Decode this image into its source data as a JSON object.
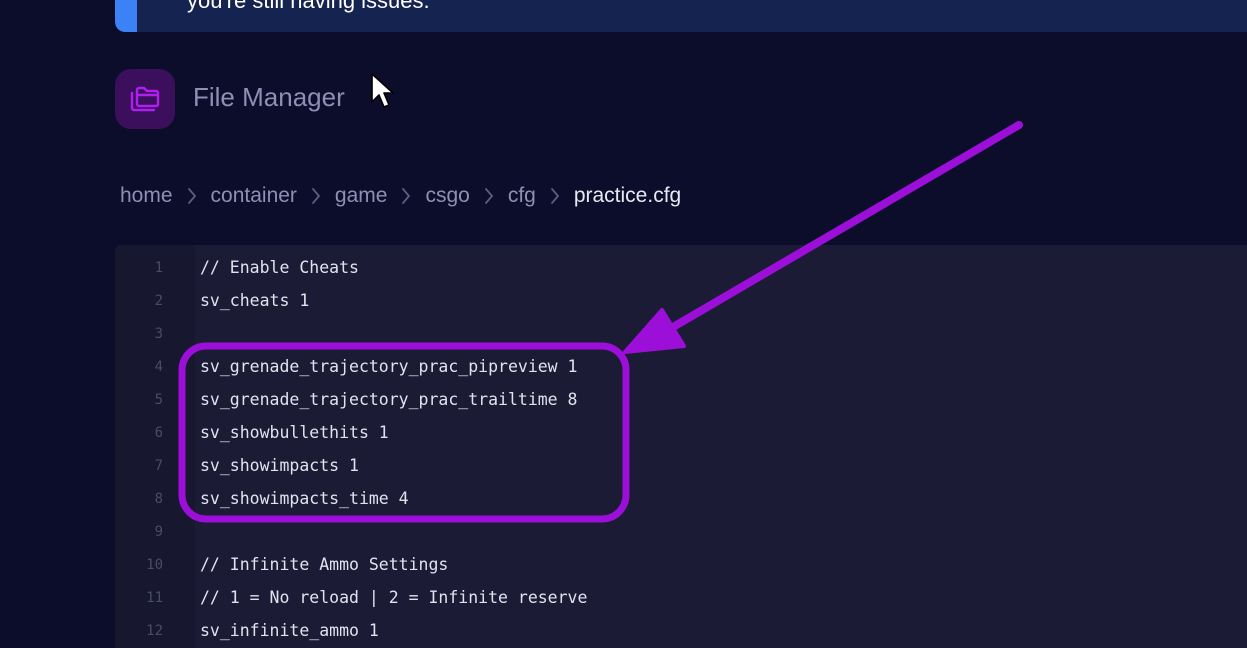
{
  "notice": {
    "text": "you're still having issues."
  },
  "header": {
    "title": "File Manager",
    "icon": "folder-icon"
  },
  "breadcrumb": {
    "items": [
      "home",
      "container",
      "game",
      "csgo",
      "cfg"
    ],
    "current": "practice.cfg"
  },
  "editor": {
    "lines": [
      {
        "num": "1",
        "code": "// Enable Cheats"
      },
      {
        "num": "2",
        "code": "sv_cheats 1"
      },
      {
        "num": "3",
        "code": ""
      },
      {
        "num": "4",
        "code": "sv_grenade_trajectory_prac_pipreview 1"
      },
      {
        "num": "5",
        "code": "sv_grenade_trajectory_prac_trailtime 8"
      },
      {
        "num": "6",
        "code": "sv_showbullethits 1"
      },
      {
        "num": "7",
        "code": "sv_showimpacts 1"
      },
      {
        "num": "8",
        "code": "sv_showimpacts_time 4"
      },
      {
        "num": "9",
        "code": ""
      },
      {
        "num": "10",
        "code": "// Infinite Ammo Settings"
      },
      {
        "num": "11",
        "code": "// 1 = No reload | 2 = Infinite reserve"
      },
      {
        "num": "12",
        "code": "sv_infinite_ammo 1"
      }
    ]
  },
  "colors": {
    "background": "#0c0d2b",
    "accent_purple": "#9b0fd8",
    "notice_accent": "#3b82f6"
  }
}
